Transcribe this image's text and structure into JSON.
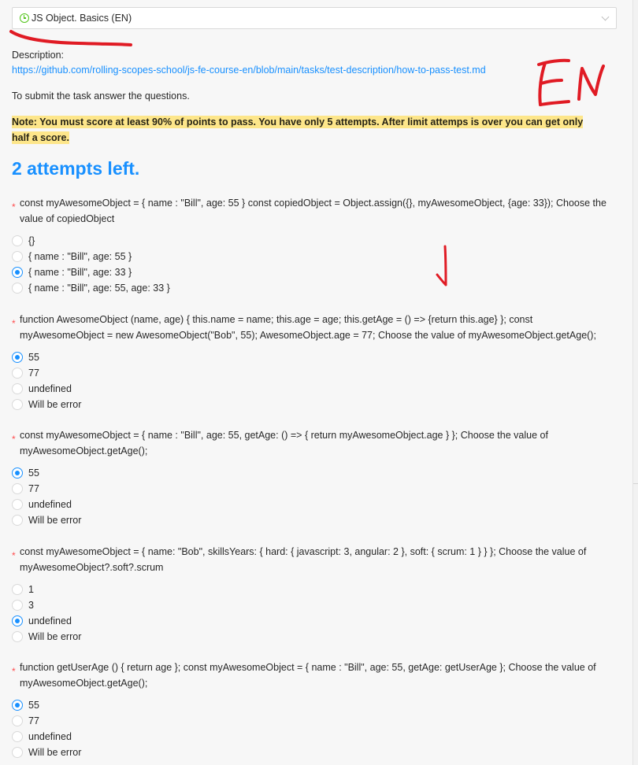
{
  "task_select": {
    "value": "JS Object. Basics (EN)",
    "icon": "clock-icon"
  },
  "description": {
    "label": "Description:",
    "link": "https://github.com/rolling-scopes-school/js-fe-course-en/blob/main/tasks/test-description/how-to-pass-test.md"
  },
  "submit_text": "To submit the task answer the questions.",
  "note": "Note: You must score at least 90% of points to pass. You have only 5 attempts. After limit attemps is over you can get only half a score.",
  "attempts_left": "2 attempts left.",
  "colors": {
    "accent": "#1890ff",
    "required": "#ff4d4f",
    "note_bg": "#fde68a",
    "annotation": "#e01b24"
  },
  "handwritten_annotations": [
    "EN"
  ],
  "questions": [
    {
      "title": "const myAwesomeObject = { name : \"Bill\", age: 55 } const copiedObject = Object.assign({}, myAwesomeObject, {age: 33}); Choose the value of copiedObject",
      "options": [
        "{}",
        "{ name : \"Bill\", age: 55 }",
        "{ name : \"Bill\", age: 33 }",
        "{ name : \"Bill\", age: 55, age: 33 }"
      ],
      "selected": 2
    },
    {
      "title": "function AwesomeObject (name, age) { this.name = name; this.age = age; this.getAge = () => {return this.age} }; const myAwesomeObject = new AwesomeObject(\"Bob\", 55); AwesomeObject.age = 77; Choose the value of myAwesomeObject.getAge();",
      "options": [
        "55",
        "77",
        "undefined",
        "Will be error"
      ],
      "selected": 0
    },
    {
      "title": "const myAwesomeObject = { name : \"Bill\", age: 55, getAge: () => { return myAwesomeObject.age } }; Choose the value of myAwesomeObject.getAge();",
      "options": [
        "55",
        "77",
        "undefined",
        "Will be error"
      ],
      "selected": 0
    },
    {
      "title": "const myAwesomeObject = { name: \"Bob\", skillsYears: { hard: { javascript: 3, angular: 2 }, soft: { scrum: 1 } } }; Choose the value of myAwesomeObject?.soft?.scrum",
      "options": [
        "1",
        "3",
        "undefined",
        "Will be error"
      ],
      "selected": 2
    },
    {
      "title": "function getUserAge () { return age }; const myAwesomeObject = { name : \"Bill\", age: 55, getAge: getUserAge }; Choose the value of myAwesomeObject.getAge();",
      "options": [
        "55",
        "77",
        "undefined",
        "Will be error"
      ],
      "selected": 0
    }
  ]
}
